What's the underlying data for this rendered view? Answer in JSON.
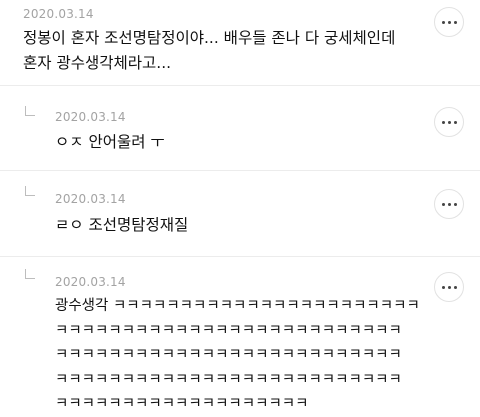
{
  "comments": [
    {
      "date": "2020.03.14",
      "text": "정봉이 혼자 조선명탐정이야... 배우들 존나 다 궁세체인데\n혼자 광수생각체라고..."
    },
    {
      "date": "2020.03.14",
      "text": "ㅇㅈ 안어울려 ㅜ"
    },
    {
      "date": "2020.03.14",
      "text": "ㄹㅇ 조선명탐정재질"
    },
    {
      "date": "2020.03.14",
      "text": "광수생각 ㅋㅋㅋㅋㅋㅋㅋㅋㅋㅋㅋㅋㅋㅋㅋㅋㅋㅋㅋㅋㅋㅋㅋ\nㅋㅋㅋㅋㅋㅋㅋㅋㅋㅋㅋㅋㅋㅋㅋㅋㅋㅋㅋㅋㅋㅋㅋㅋㅋㅋ\nㅋㅋㅋㅋㅋㅋㅋㅋㅋㅋㅋㅋㅋㅋㅋㅋㅋㅋㅋㅋㅋㅋㅋㅋㅋㅋ\nㅋㅋㅋㅋㅋㅋㅋㅋㅋㅋㅋㅋㅋㅋㅋㅋㅋㅋㅋㅋㅋㅋㅋㅋㅋㅋ\nㅋㅋㅋㅋㅋㅋㅋㅋㅋㅋㅋㅋㅋㅋㅋㅋㅋㅋㅋ"
    }
  ],
  "icons": {
    "more": "more-icon",
    "reply": "reply-arrow-icon"
  }
}
